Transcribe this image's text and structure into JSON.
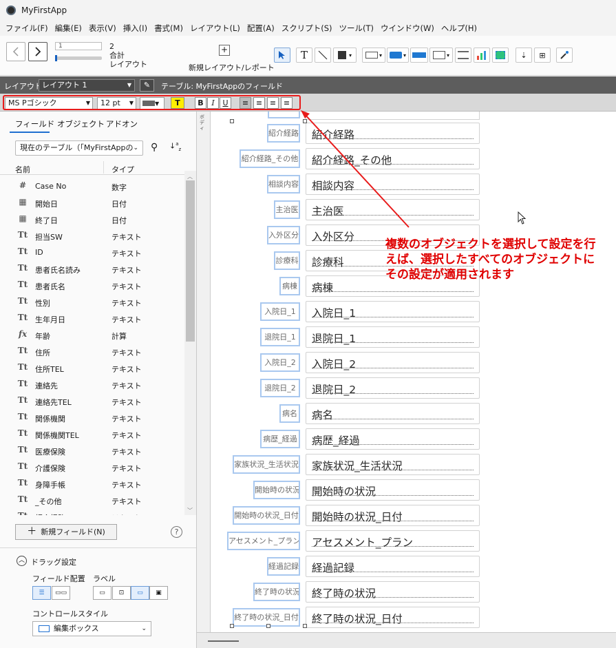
{
  "app": {
    "title": "MyFirstApp"
  },
  "menu": [
    "ファイル(F)",
    "編集(E)",
    "表示(V)",
    "挿入(I)",
    "書式(M)",
    "レイアウト(L)",
    "配置(A)",
    "スクリプト(S)",
    "ツール(T)",
    "ウインドウ(W)",
    "ヘルプ(H)"
  ],
  "toolbar": {
    "record_value": "1",
    "record_total": "2",
    "record_total_label": "合計",
    "record_unit_label": "レイアウト",
    "new_layout_label": "新規レイアウト/レポート"
  },
  "layout_bar": {
    "label": "レイアウト:",
    "layout_name": "レイアウト 1",
    "table_text": "テーブル: MyFirstAppのフィールド"
  },
  "format_bar": {
    "font": "MS Pゴシック",
    "size": "12 pt",
    "highlight_label": "T",
    "bold": "B",
    "italic": "I",
    "underline": "U",
    "accent_color": "#e81b1b"
  },
  "left_panel": {
    "tabs": [
      "フィールド",
      "オブジェクト",
      "アドオン"
    ],
    "table_select": "現在のテーブル（「MyFirstAppの",
    "col_name": "名前",
    "col_type": "タイプ",
    "fields": [
      {
        "icon": "#",
        "icon_name": "number-icon",
        "name": "Case No",
        "type": "数字"
      },
      {
        "icon": "▦",
        "icon_name": "date-icon",
        "name": "開始日",
        "type": "日付"
      },
      {
        "icon": "▦",
        "icon_name": "date-icon",
        "name": "終了日",
        "type": "日付"
      },
      {
        "icon": "Tt",
        "icon_name": "text-icon",
        "name": "担当SW",
        "type": "テキスト"
      },
      {
        "icon": "Tt",
        "icon_name": "text-icon",
        "name": "ID",
        "type": "テキスト"
      },
      {
        "icon": "Tt",
        "icon_name": "text-icon",
        "name": "患者氏名読み",
        "type": "テキスト"
      },
      {
        "icon": "Tt",
        "icon_name": "text-icon",
        "name": "患者氏名",
        "type": "テキスト"
      },
      {
        "icon": "Tt",
        "icon_name": "text-icon",
        "name": "性別",
        "type": "テキスト"
      },
      {
        "icon": "Tt",
        "icon_name": "text-icon",
        "name": "生年月日",
        "type": "テキスト"
      },
      {
        "icon": "fx",
        "icon_name": "calc-icon",
        "name": "年齢",
        "type": "計算"
      },
      {
        "icon": "Tt",
        "icon_name": "text-icon",
        "name": "住所",
        "type": "テキスト"
      },
      {
        "icon": "Tt",
        "icon_name": "text-icon",
        "name": "住所TEL",
        "type": "テキスト"
      },
      {
        "icon": "Tt",
        "icon_name": "text-icon",
        "name": "連絡先",
        "type": "テキスト"
      },
      {
        "icon": "Tt",
        "icon_name": "text-icon",
        "name": "連絡先TEL",
        "type": "テキスト"
      },
      {
        "icon": "Tt",
        "icon_name": "text-icon",
        "name": "関係機関",
        "type": "テキスト"
      },
      {
        "icon": "Tt",
        "icon_name": "text-icon",
        "name": "関係機関TEL",
        "type": "テキスト"
      },
      {
        "icon": "Tt",
        "icon_name": "text-icon",
        "name": "医療保険",
        "type": "テキスト"
      },
      {
        "icon": "Tt",
        "icon_name": "text-icon",
        "name": "介護保険",
        "type": "テキスト"
      },
      {
        "icon": "Tt",
        "icon_name": "text-icon",
        "name": "身障手帳",
        "type": "テキスト"
      },
      {
        "icon": "Tt",
        "icon_name": "text-icon",
        "name": "_その他",
        "type": "テキスト"
      },
      {
        "icon": "Tt",
        "icon_name": "text-icon",
        "name": "紹介経路",
        "type": "テキスト"
      }
    ],
    "new_field_button": "新規フィールド(N)",
    "drag_settings": "ドラッグ設定",
    "field_placement": "フィールド配置",
    "label_heading": "ラベル",
    "control_style": "コントロールスタイル",
    "control_style_value": "編集ボックス"
  },
  "canvas": {
    "body_part_label": "ボディ",
    "rows": [
      {
        "label": "紹介経路",
        "field": "紹介経路"
      },
      {
        "label": "紹介経路_その他",
        "field": "紹介経路_その他"
      },
      {
        "label": "相談内容",
        "field": "相談内容"
      },
      {
        "label": "主治医",
        "field": "主治医"
      },
      {
        "label": "入外区分",
        "field": "入外区分"
      },
      {
        "label": "診療科",
        "field": "診療科"
      },
      {
        "label": "病棟",
        "field": "病棟"
      },
      {
        "label": "入院日_1",
        "field": "入院日_1"
      },
      {
        "label": "退院日_1",
        "field": "退院日_1"
      },
      {
        "label": "入院日_2",
        "field": "入院日_2"
      },
      {
        "label": "退院日_2",
        "field": "退院日_2"
      },
      {
        "label": "病名",
        "field": "病名"
      },
      {
        "label": "病歴_経過",
        "field": "病歴_経過"
      },
      {
        "label": "家族状況_生活状況",
        "field": "家族状況_生活状況"
      },
      {
        "label": "開始時の状況",
        "field": "開始時の状況"
      },
      {
        "label": "開始時の状況_日付",
        "field": "開始時の状況_日付"
      },
      {
        "label": "アセスメント_プラン",
        "field": "アセスメント_プラン"
      },
      {
        "label": "経過記録",
        "field": "経過記録"
      },
      {
        "label": "終了時の状況",
        "field": "終了時の状況"
      },
      {
        "label": "終了時の状況_日付",
        "field": "終了時の状況_日付"
      }
    ],
    "annotation": "複数のオブジェクトを選択して設定を行えば、選択したすべてのオブジェクトにその設定が適用されます"
  }
}
